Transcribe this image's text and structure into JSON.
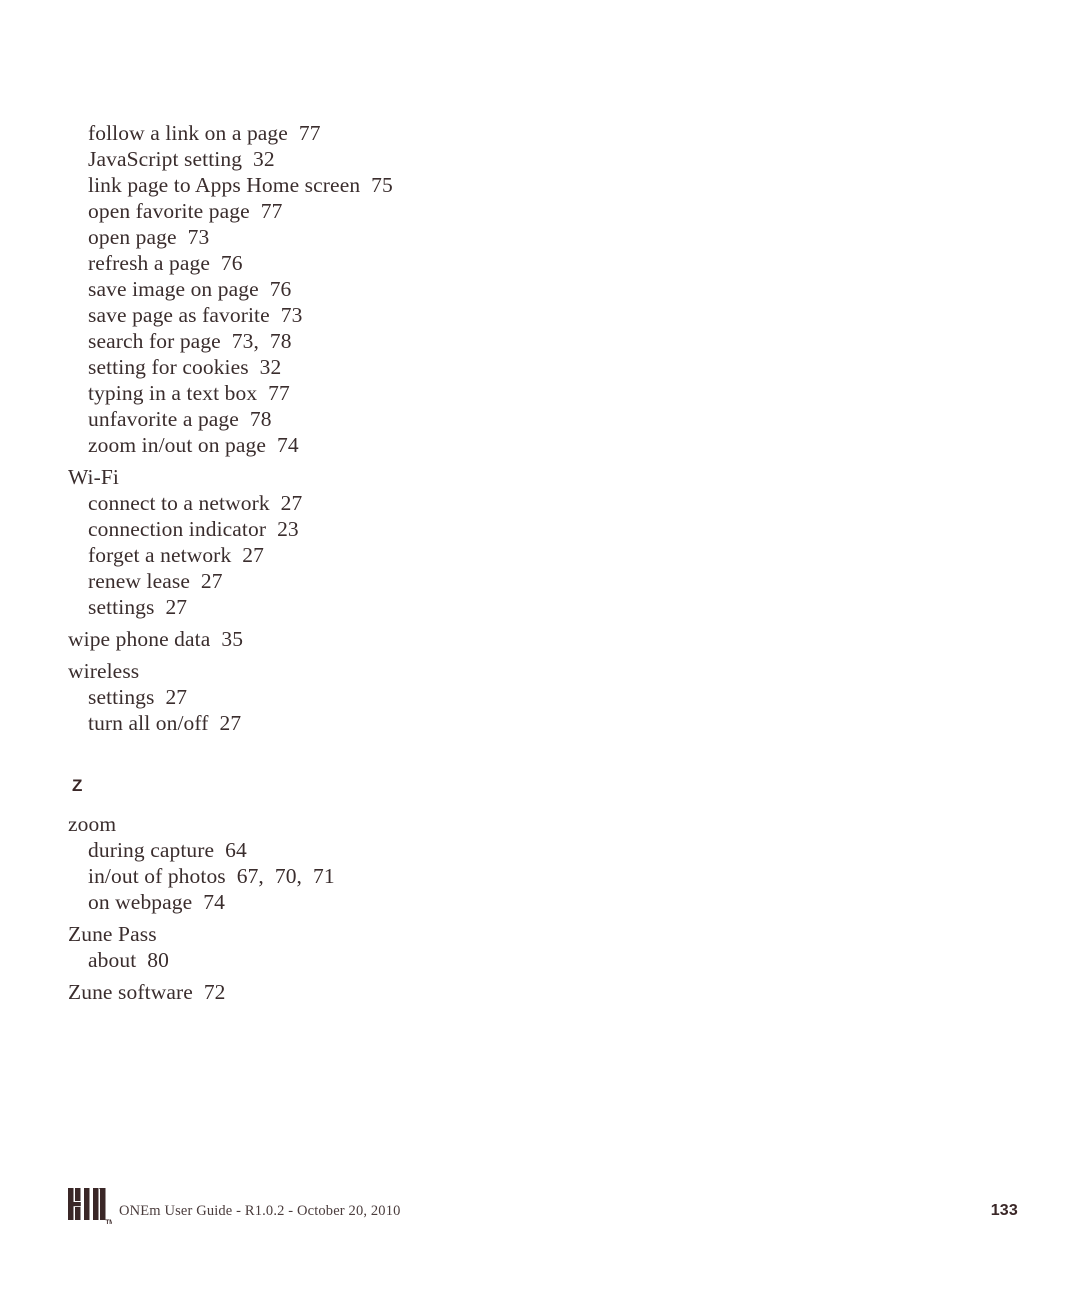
{
  "document": {
    "type": "index-page",
    "page_number": "133",
    "text_color": "#3a2d2d",
    "background_color": "#ffffff"
  },
  "index": {
    "blocks": [
      {
        "id": "web-browser-continued",
        "entries": [
          {
            "level": 1,
            "text": "follow a link on a page  77"
          },
          {
            "level": 1,
            "text": "JavaScript setting  32"
          },
          {
            "level": 1,
            "text": "link page to Apps Home screen  75"
          },
          {
            "level": 1,
            "text": "open favorite page  77"
          },
          {
            "level": 1,
            "text": "open page  73"
          },
          {
            "level": 1,
            "text": "refresh a page  76"
          },
          {
            "level": 1,
            "text": "save image on page  76"
          },
          {
            "level": 1,
            "text": "save page as favorite  73"
          },
          {
            "level": 1,
            "text": "search for page  73,  78"
          },
          {
            "level": 1,
            "text": "setting for cookies  32"
          },
          {
            "level": 1,
            "text": "typing in a text box  77"
          },
          {
            "level": 1,
            "text": "unfavorite a page  78"
          },
          {
            "level": 1,
            "text": "zoom in/out on page  74"
          },
          {
            "level": 0,
            "text": "Wi-Fi"
          },
          {
            "level": 1,
            "text": "connect to a network  27"
          },
          {
            "level": 1,
            "text": "connection indicator  23"
          },
          {
            "level": 1,
            "text": "forget a network  27"
          },
          {
            "level": 1,
            "text": "renew lease  27"
          },
          {
            "level": 1,
            "text": "settings  27"
          },
          {
            "level": 0,
            "text": "wipe phone data  35"
          },
          {
            "level": 0,
            "text": "wireless"
          },
          {
            "level": 1,
            "text": "settings  27"
          },
          {
            "level": 1,
            "text": "turn all on/off  27"
          }
        ]
      }
    ],
    "section_letter": "Z",
    "z_entries": [
      {
        "level": 0,
        "text": "zoom"
      },
      {
        "level": 1,
        "text": "during capture  64"
      },
      {
        "level": 1,
        "text": "in/out of photos  67,  70,  71"
      },
      {
        "level": 1,
        "text": "on webpage  74"
      },
      {
        "level": 0,
        "text": "Zune Pass"
      },
      {
        "level": 1,
        "text": "about  80"
      },
      {
        "level": 0,
        "text": "Zune software  72"
      }
    ]
  },
  "footer": {
    "logo_name": "kin-logo",
    "logo_text": "KIN",
    "trademark": "TM",
    "caption": "ONEm User Guide - R1.0.2 - October 20, 2010",
    "page_number": "133"
  }
}
